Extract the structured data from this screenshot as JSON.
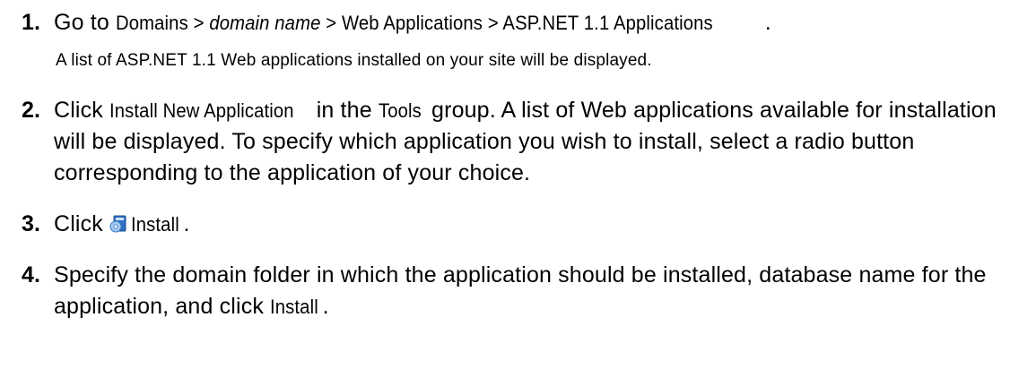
{
  "steps": [
    {
      "number": "1.",
      "prefix": "Go to ",
      "path_domains": "Domains",
      "sep1": " > ",
      "path_domain_name": "domain name",
      "sep2": " > ",
      "path_web_apps": "Web Applications",
      "sep3": " > ",
      "path_aspnet": "ASP.NET 1.1 Applications",
      "suffix": ".",
      "note": "A list of ASP.NET 1.1 Web applications installed on your site will be displayed."
    },
    {
      "number": "2.",
      "prefix": "Click ",
      "action": "Install New Application",
      "mid": " in the ",
      "group": "Tools",
      "rest": " group. A list of Web applications available for installation will be displayed. To specify which application you wish to install, select a radio button corresponding to the application of your choice."
    },
    {
      "number": "3.",
      "prefix": "Click ",
      "icon": "install-icon",
      "action": "Install",
      "suffix": "."
    },
    {
      "number": "4.",
      "prefix": "Specify the domain folder in which the application should be installed, database name for the application, and click ",
      "action": "Install",
      "suffix": "."
    }
  ]
}
